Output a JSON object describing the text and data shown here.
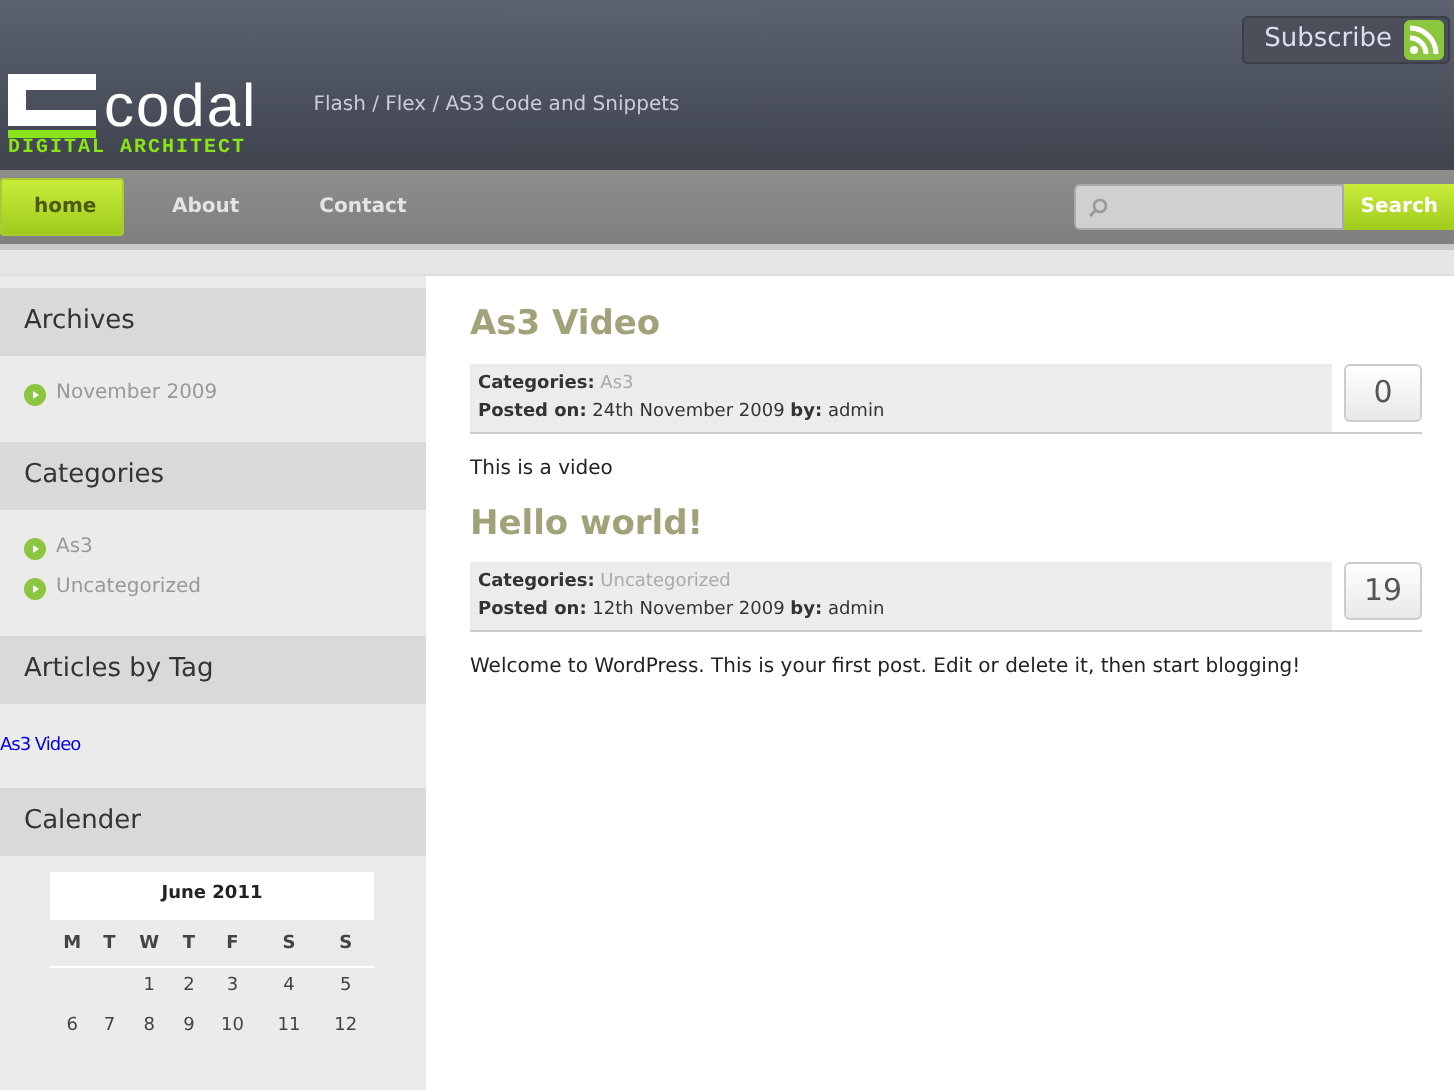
{
  "header": {
    "logo_word": "codal",
    "logo_tagline": "DIGITAL ARCHITECT",
    "site_description": "Flash / Flex / AS3 Code and Snippets",
    "subscribe": "Subscribe"
  },
  "nav": [
    {
      "label": "home",
      "selected": true
    },
    {
      "label": "About",
      "selected": false
    },
    {
      "label": "Contact",
      "selected": false
    }
  ],
  "search": {
    "button": "Search"
  },
  "sidebar": [
    {
      "title": "Archives",
      "kind": "bullets",
      "items": [
        "November 2009"
      ]
    },
    {
      "title": "Categories",
      "kind": "bullets",
      "items": [
        "As3",
        "Uncategorized"
      ]
    },
    {
      "title": "Articles by Tag",
      "kind": "tags",
      "items": [
        "As3 Video"
      ]
    },
    {
      "title": "Calender",
      "kind": "calendar",
      "caption": "June 2011",
      "days": [
        "M",
        "T",
        "W",
        "T",
        "F",
        "S",
        "S"
      ],
      "weeks": [
        {
          "kind": "first",
          "days": [
            "1",
            "2",
            "3",
            "4",
            "5"
          ]
        },
        {
          "kind": "full",
          "days": [
            "6",
            "7",
            "8",
            "9",
            "10",
            "11",
            "12"
          ]
        }
      ]
    }
  ],
  "posts": [
    {
      "title": "As3 Video",
      "categories_label": "Categories:",
      "category": "As3",
      "posted": "**Posted on:** 24th November 2009 **by:** admin",
      "comments": "0",
      "body": "This is a video"
    },
    {
      "title": "Hello world!",
      "categories_label": "Categories:",
      "category": "Uncategorized",
      "posted": "**Posted on:** 12th November 2009 **by:** admin",
      "comments": "19",
      "body": "Welcome to WordPress. This is your first post. Edit or delete it, then start blogging!"
    }
  ]
}
